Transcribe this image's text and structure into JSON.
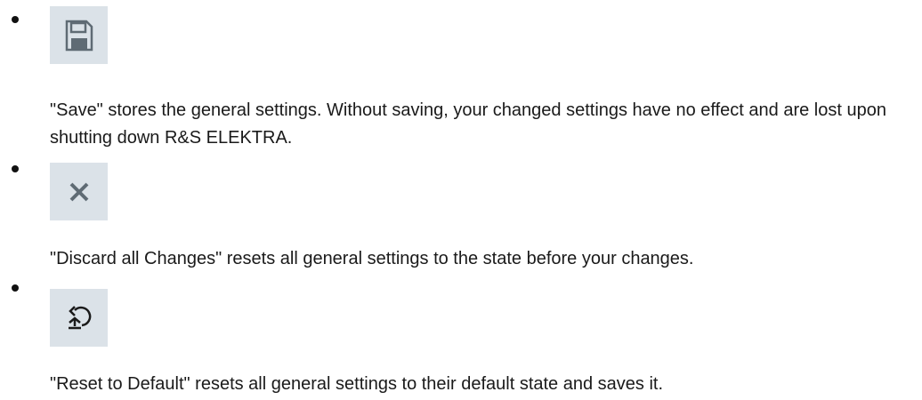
{
  "items": [
    {
      "icon": "save-icon",
      "description": "\"Save\" stores the general settings. Without saving, your changed settings have no effect and are lost upon shutting down R&S ELEKTRA."
    },
    {
      "icon": "close-icon",
      "description": "\"Discard all Changes\" resets all general settings to the state before your changes."
    },
    {
      "icon": "reset-icon",
      "description": "\"Reset to Default\" resets all general settings to their default state and saves it."
    }
  ],
  "colors": {
    "icon_background": "#dbe2e8",
    "icon_foreground": "#5f6b74",
    "text": "#1a1a1a"
  }
}
